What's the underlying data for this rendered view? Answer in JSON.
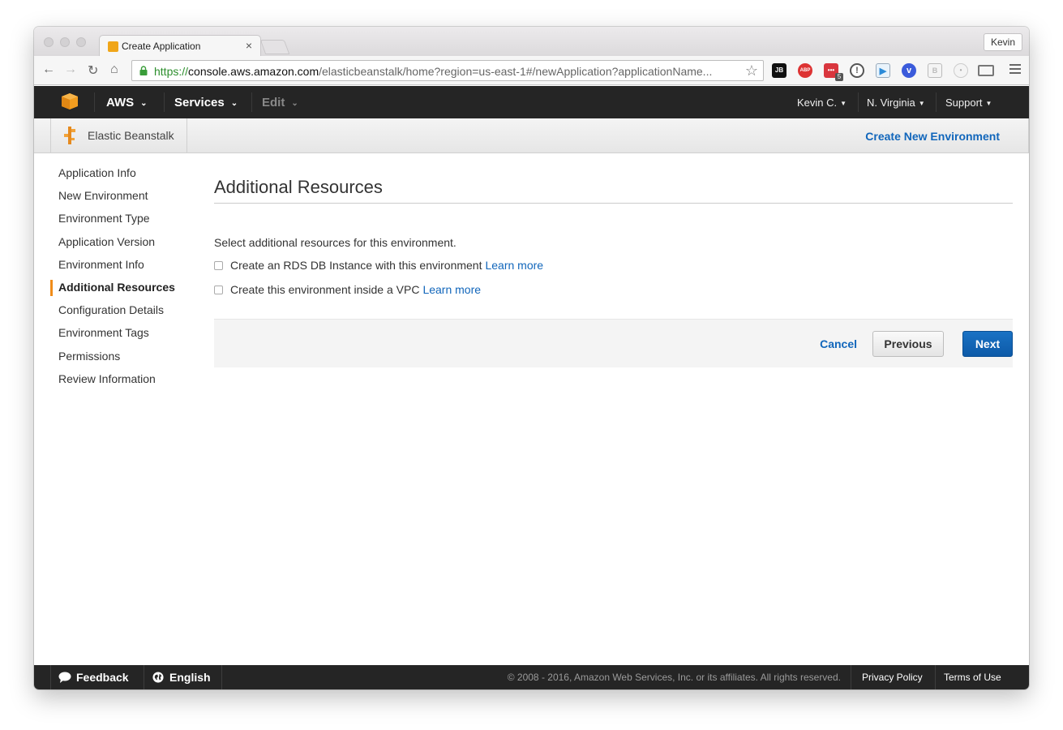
{
  "browser": {
    "tab_title": "Create Application",
    "tab_close": "×",
    "profile": "Kevin",
    "url_scheme": "https://",
    "url_host": "console.aws.amazon.com",
    "url_path": "/elasticbeanstalk/home?region=us-east-1#/newApplication?applicationName...",
    "extensions": {
      "jb": "JB",
      "abp": "ABP",
      "badge": "5"
    }
  },
  "aws_nav": {
    "aws_label": "AWS",
    "services_label": "Services",
    "edit_label": "Edit",
    "user_label": "Kevin C.",
    "region_label": "N. Virginia",
    "support_label": "Support"
  },
  "service_bar": {
    "service_name": "Elastic Beanstalk",
    "create_env_label": "Create New Environment"
  },
  "sidebar": {
    "steps": [
      {
        "label": "Application Info"
      },
      {
        "label": "New Environment"
      },
      {
        "label": "Environment Type"
      },
      {
        "label": "Application Version"
      },
      {
        "label": "Environment Info"
      },
      {
        "label": "Additional Resources"
      },
      {
        "label": "Configuration Details"
      },
      {
        "label": "Environment Tags"
      },
      {
        "label": "Permissions"
      },
      {
        "label": "Review Information"
      }
    ],
    "active_step": "Additional Resources"
  },
  "main": {
    "title": "Additional Resources",
    "intro": "Select additional resources for this environment.",
    "options": [
      {
        "label": "Create an RDS DB Instance with this environment",
        "link": "Learn more",
        "checked": false
      },
      {
        "label": "Create this environment inside a VPC",
        "link": "Learn more",
        "checked": false
      }
    ],
    "cancel_label": "Cancel",
    "previous_label": "Previous",
    "next_label": "Next"
  },
  "footer": {
    "feedback_label": "Feedback",
    "language_label": "English",
    "copyright": "© 2008 - 2016, Amazon Web Services, Inc. or its affiliates. All rights reserved.",
    "privacy_label": "Privacy Policy",
    "terms_label": "Terms of Use"
  },
  "colors": {
    "accent_link": "#1166bb",
    "active_step_marker": "#f08c1a",
    "nav_bg": "#252525",
    "next_button": "#1a72c4"
  }
}
